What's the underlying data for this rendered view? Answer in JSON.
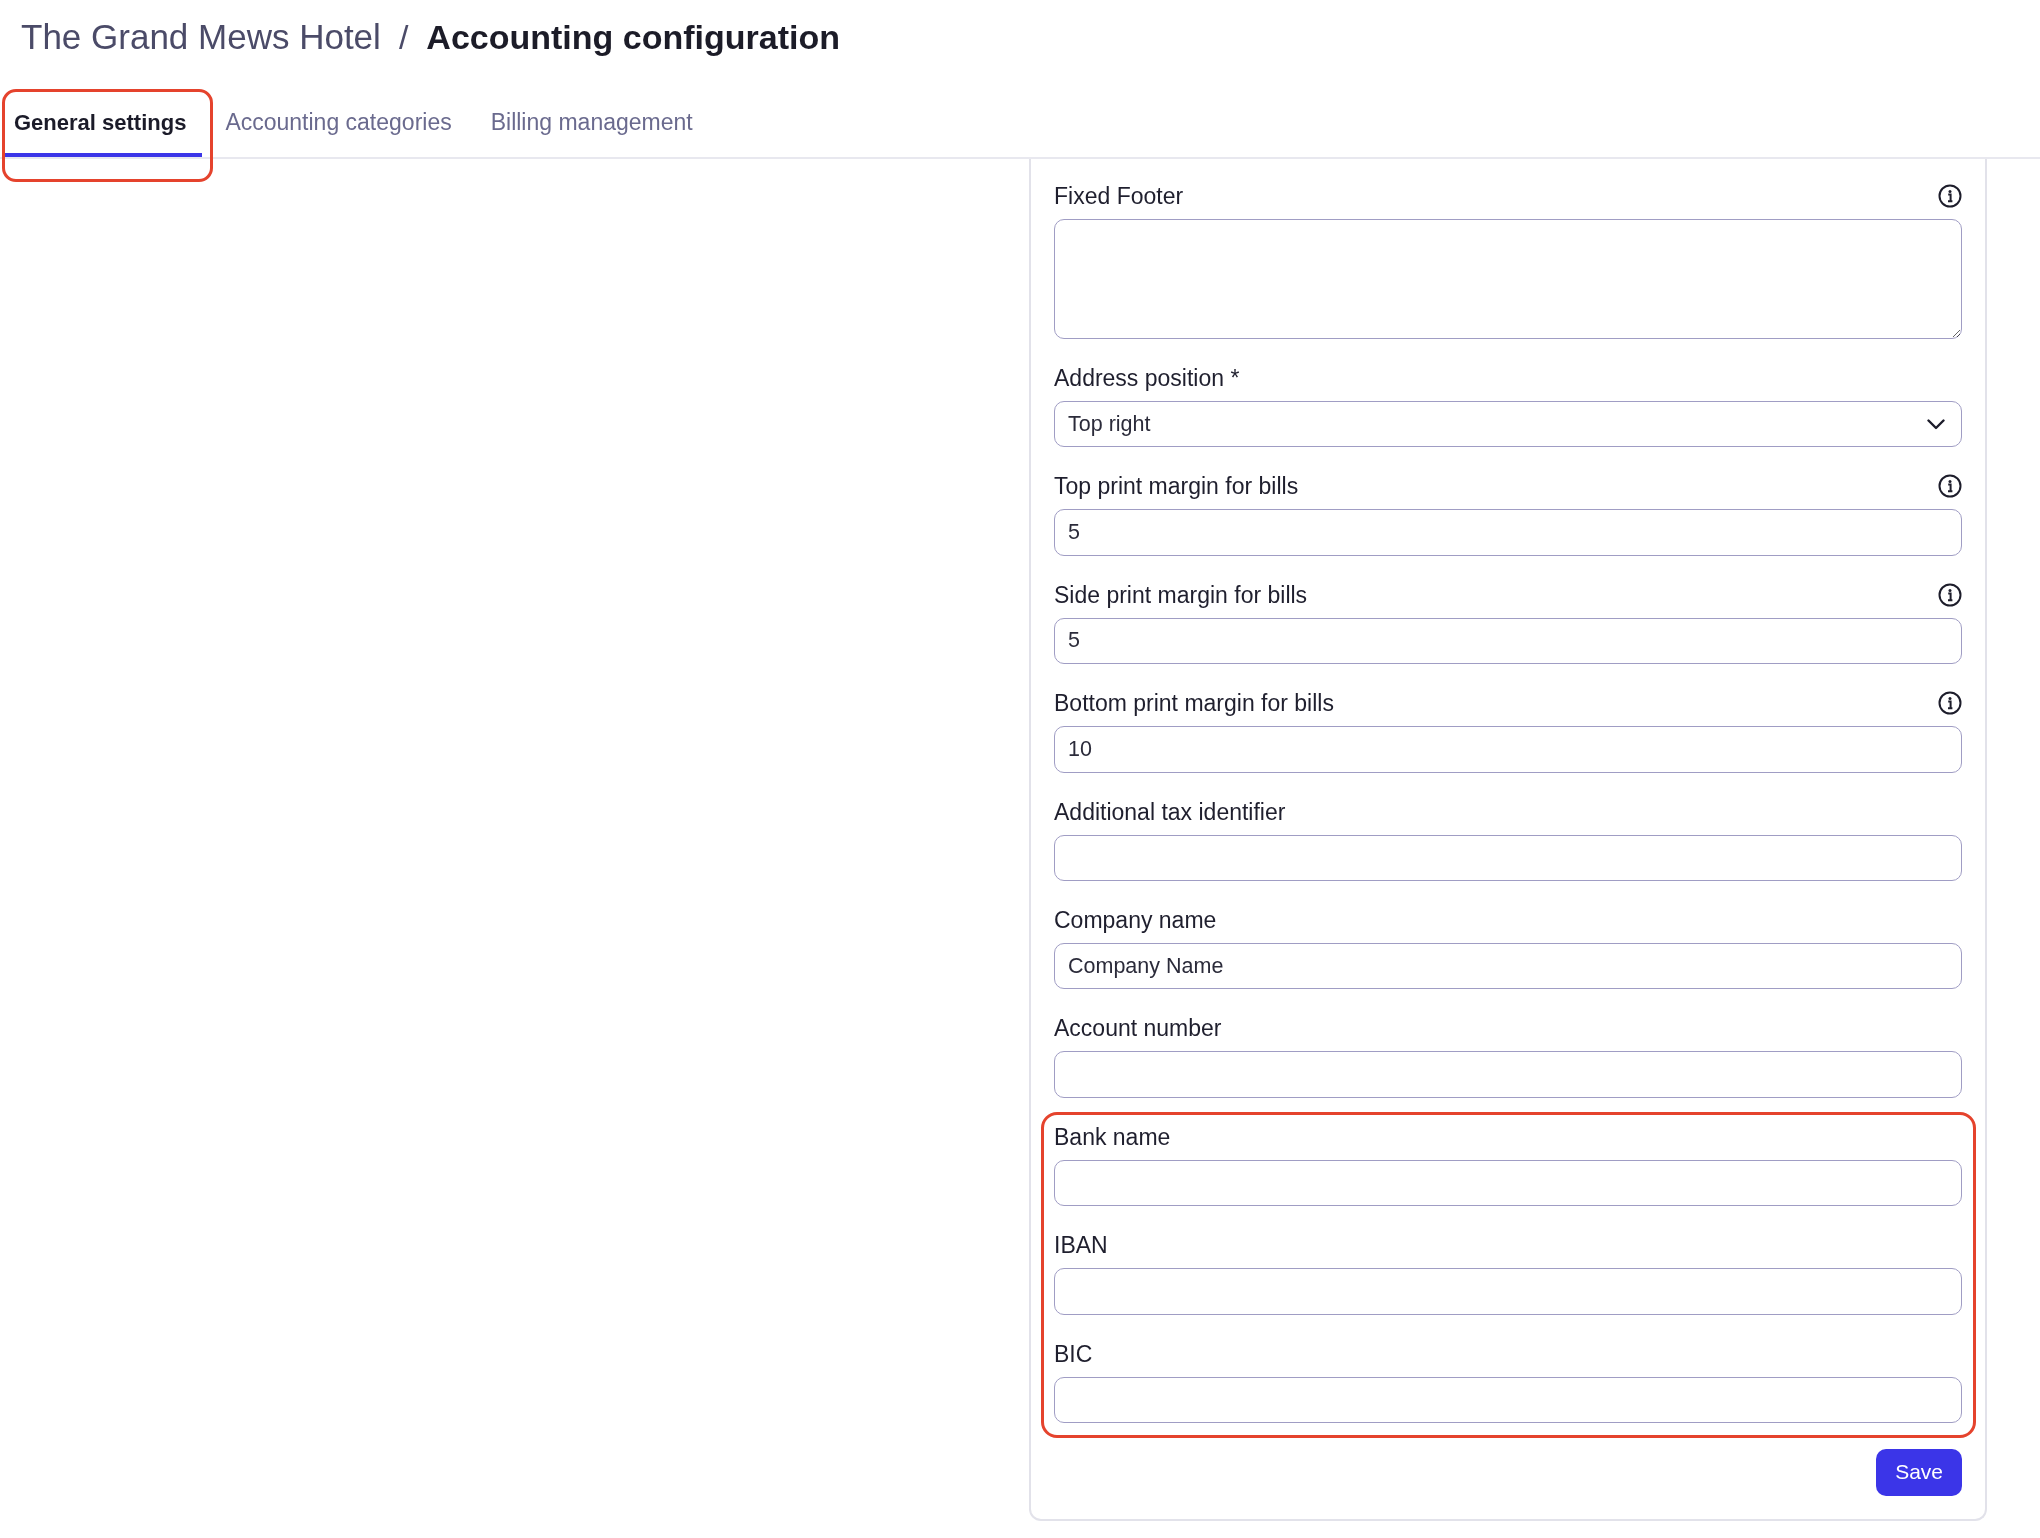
{
  "breadcrumb": {
    "parent": "The Grand Mews Hotel",
    "separator": "/",
    "current": "Accounting configuration"
  },
  "tabs": [
    {
      "label": "General settings",
      "selected": true,
      "highlighted": true
    },
    {
      "label": "Accounting categories",
      "selected": false,
      "highlighted": false
    },
    {
      "label": "Billing management",
      "selected": false,
      "highlighted": false
    }
  ],
  "form": {
    "sections": [
      {
        "highlighted": false,
        "fields": [
          {
            "kind": "textarea",
            "label": "Fixed Footer",
            "info": true
          },
          {
            "kind": "select",
            "label": "Address position *",
            "info": false,
            "value": "Top right"
          },
          {
            "kind": "text",
            "label": "Top print margin for bills",
            "info": true,
            "value": "5"
          },
          {
            "kind": "text",
            "label": "Side print margin for bills",
            "info": true,
            "value": "5"
          },
          {
            "kind": "text",
            "label": "Bottom print margin for bills",
            "info": true,
            "value": "10"
          },
          {
            "kind": "text",
            "label": "Additional tax identifier",
            "info": false
          },
          {
            "kind": "text",
            "label": "Company name",
            "info": false,
            "value": "Company Name"
          },
          {
            "kind": "text",
            "label": "Account number",
            "info": false
          }
        ]
      },
      {
        "highlighted": true,
        "fields": [
          {
            "kind": "text",
            "label": "Bank name",
            "info": false
          },
          {
            "kind": "text",
            "label": "IBAN",
            "info": false
          },
          {
            "kind": "text",
            "label": "BIC",
            "info": false
          }
        ]
      }
    ],
    "save_button": "Save"
  }
}
